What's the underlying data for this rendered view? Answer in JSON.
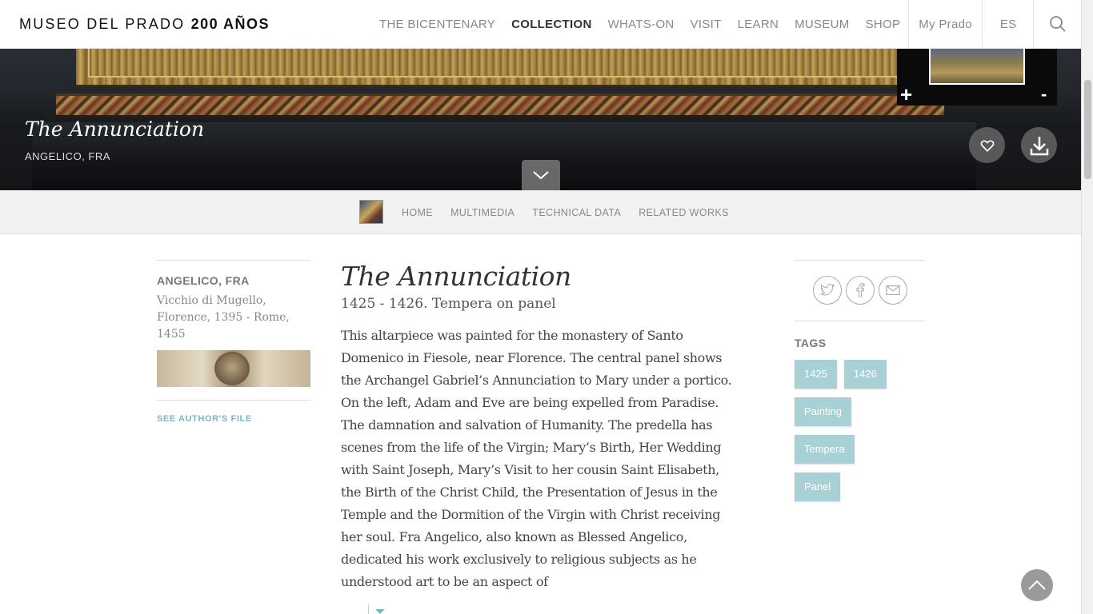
{
  "brand": {
    "logo_text": "MUSEO DEL PRADO",
    "logo_bold": "200 AÑOS"
  },
  "nav": {
    "items": [
      "THE BICENTENARY",
      "COLLECTION",
      "WHATS-ON",
      "VISIT",
      "LEARN",
      "MUSEUM",
      "SHOP"
    ],
    "active": "COLLECTION",
    "my_prado": "My Prado",
    "language": "ES"
  },
  "hero": {
    "title": "The Annunciation",
    "artist": "ANGELICO, FRA",
    "zoom_in": "+",
    "zoom_out": "-"
  },
  "subnav": {
    "items": [
      "HOME",
      "MULTIMEDIA",
      "TECHNICAL DATA",
      "RELATED WORKS"
    ]
  },
  "artist_panel": {
    "name": "ANGELICO, FRA",
    "bio": "Vicchio di Mugello, Florence, 1395 - Rome, 1455",
    "see_file": "SEE AUTHOR'S FILE"
  },
  "artwork": {
    "title": "The Annunciation",
    "date_technique": "1425 - 1426. Tempera on panel",
    "description": "This altarpiece was painted for the monastery of Santo Domenico in Fiesole, near Florence. The central panel shows the Archangel Gabriel’s Annunciation to Mary under a portico. On the left, Adam and Eve are being expelled from Paradise. The damnation and salvation of Humanity. The predella has scenes from the life of the Virgin; Mary’s Birth, Her Wedding with Saint Joseph, Mary’s Visit to her cousin Saint Elisabeth, the Birth of the Christ Child, the Presentation of Jesus in the Temple and the Dormition of the Virgin with Christ receiving her soul. Fra Angelico, also known as Blessed Angelico, dedicated his work exclusively to religious subjects as he understood art to be an aspect of"
  },
  "tags": {
    "title": "TAGS",
    "items": [
      "1425",
      "1426",
      "Painting",
      "Tempera",
      "Panel"
    ]
  },
  "colors": {
    "tag_bg": "#a8d1d5",
    "link_accent": "#7fb5bb"
  }
}
